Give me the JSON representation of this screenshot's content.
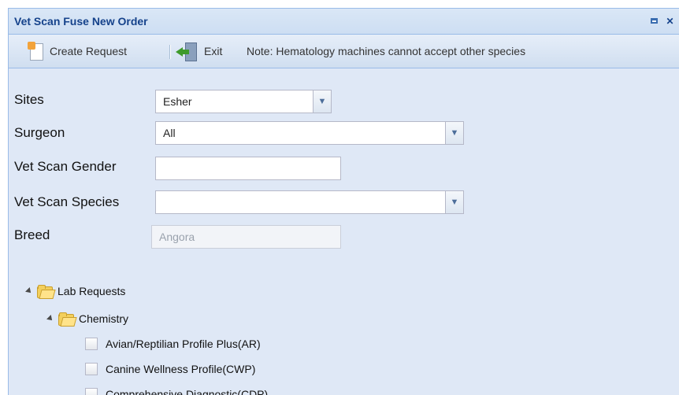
{
  "window": {
    "title": "Vet Scan Fuse New Order"
  },
  "toolbar": {
    "create_request_label": "Create Request",
    "exit_label": "Exit",
    "note": "Note: Hematology machines cannot accept other species"
  },
  "form": {
    "sites": {
      "label": "Sites",
      "value": "Esher"
    },
    "surgeon": {
      "label": "Surgeon",
      "value": "All"
    },
    "gender": {
      "label": "Vet Scan Gender",
      "value": ""
    },
    "species": {
      "label": "Vet Scan Species",
      "value": ""
    },
    "breed": {
      "label": "Breed",
      "value": "Angora"
    }
  },
  "tree": {
    "root_label": "Lab Requests",
    "chemistry_label": "Chemistry",
    "items": [
      {
        "label": "Avian/Reptilian Profile Plus(AR)",
        "checked": false
      },
      {
        "label": "Canine Wellness Profile(CWP)",
        "checked": false
      },
      {
        "label": "Comprehensive Diagnostic(CDP)",
        "checked": false
      }
    ]
  },
  "icons": {
    "create_request": "document-icon",
    "exit": "exit-icon",
    "dropdown": "chevron-down-icon",
    "folder": "folder-icon",
    "expand": "expand-icon"
  },
  "colors": {
    "panel_bg": "#dfe8f6",
    "title_text": "#15428b",
    "border": "#99bbe8"
  }
}
